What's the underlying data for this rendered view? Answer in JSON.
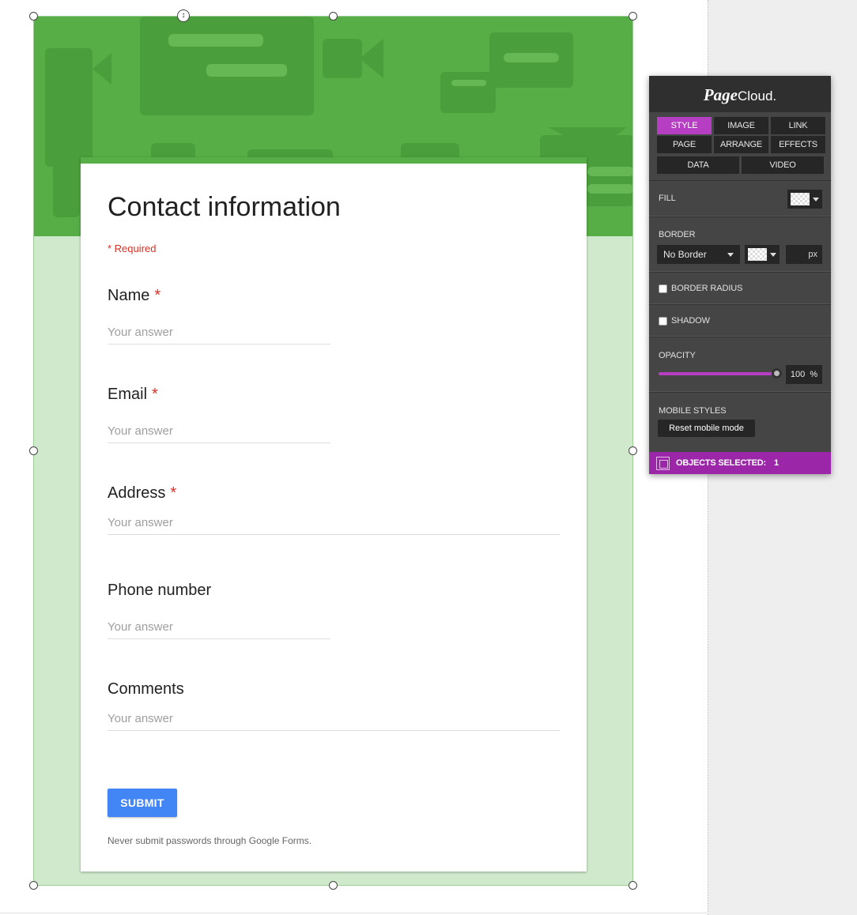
{
  "form": {
    "title": "Contact information",
    "required_note": "* Required",
    "questions": [
      {
        "label": "Name",
        "required": "*",
        "placeholder": "Your answer"
      },
      {
        "label": "Email",
        "required": "*",
        "placeholder": "Your answer"
      },
      {
        "label": "Address",
        "required": "*",
        "placeholder": "Your answer"
      },
      {
        "label": "Phone number",
        "required": "",
        "placeholder": "Your answer"
      },
      {
        "label": "Comments",
        "required": "",
        "placeholder": "Your answer"
      }
    ],
    "submit_label": "SUBMIT",
    "footer_note": "Never submit passwords through Google Forms."
  },
  "panel": {
    "brand_a": "Page",
    "brand_b": "Cloud.",
    "tabs": [
      "STYLE",
      "IMAGE",
      "LINK",
      "PAGE",
      "ARRANGE",
      "EFFECTS"
    ],
    "tabs_row2": [
      "DATA",
      "VIDEO"
    ],
    "active_tab": "STYLE",
    "fill_label": "FILL",
    "border_label": "BORDER",
    "border_style": "No Border",
    "border_unit": "px",
    "border_radius_label": "BORDER RADIUS",
    "shadow_label": "SHADOW",
    "opacity_label": "OPACITY",
    "opacity_value": "100",
    "opacity_unit": "%",
    "opacity_level": 1.0,
    "mobile_label": "MOBILE STYLES",
    "reset_label": "Reset mobile mode",
    "objects_selected_label": "OBJECTS SELECTED:",
    "objects_selected_count": "1"
  },
  "colors": {
    "banner": "#57ad46",
    "page_bg": "#d0e9cc",
    "accent_purple": "#b53ec2",
    "submit_blue": "#4285f4",
    "required_red": "#d93025"
  },
  "icons": [
    "move-handle-icon",
    "selection-icon",
    "dropdown-caret-icon"
  ]
}
